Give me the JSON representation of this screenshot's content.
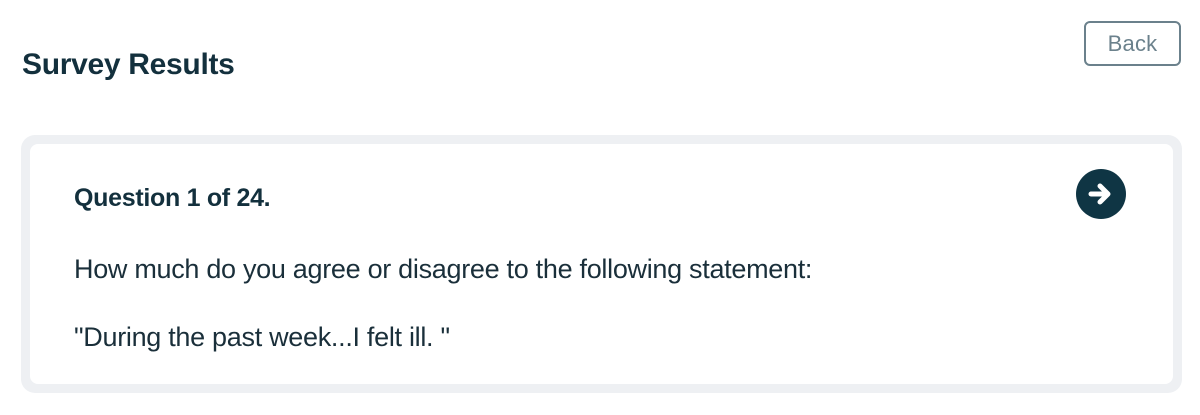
{
  "header": {
    "title": "Survey Results",
    "back_label": "Back"
  },
  "question": {
    "count_label": "Question 1 of 24.",
    "prompt": "How much do you agree or disagree to the following statement:",
    "statement": "\"During the past week...I felt ill. \""
  },
  "icons": {
    "next": "arrow-right-circle-icon"
  },
  "colors": {
    "primary": "#0f3544",
    "muted_border": "#6b818c",
    "card_frame": "#eef0f3"
  }
}
